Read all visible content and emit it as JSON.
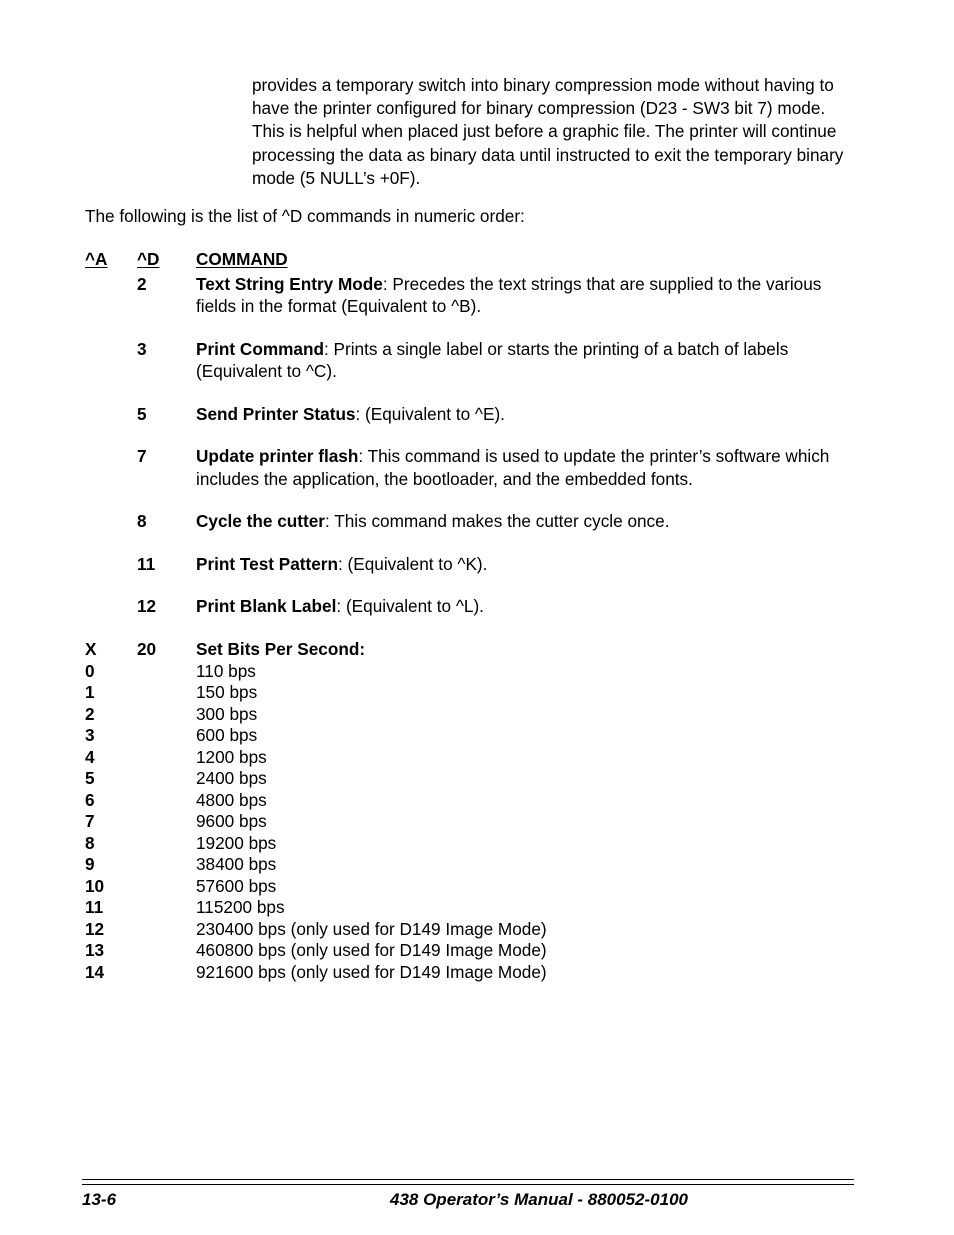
{
  "document": {
    "intro_paragraph": "provides a temporary switch into binary compression mode without having to have the printer configured for binary compression (D23 - SW3 bit 7) mode.  This is helpful when placed just before a graphic file. The printer will continue processing the data as binary data until instructed to exit the temporary binary mode (5 NULL’s +0F).",
    "lead_in": "The following is the list of ^D commands in numeric order:"
  },
  "command_table": {
    "headers": {
      "col_a": "^A",
      "col_d": "^D",
      "col_command": "COMMAND"
    },
    "rows": [
      {
        "col_a": "",
        "col_d": "2",
        "term": "Text String Entry Mode",
        "description": ": Precedes the text strings that are supplied to the various fields in the format (Equivalent to ^B)."
      },
      {
        "col_a": "",
        "col_d": "3",
        "term": "Print Command",
        "description": ": Prints a single label or starts the printing of a batch of labels (Equivalent to ^C)."
      },
      {
        "col_a": "",
        "col_d": "5",
        "term": "Send Printer Status",
        "description": ": (Equivalent to ^E)."
      },
      {
        "col_a": "",
        "col_d": "7",
        "term": "Update printer flash",
        "description": ":  This command is used to update the printer’s software which includes the application, the bootloader, and the embedded fonts."
      },
      {
        "col_a": "",
        "col_d": "8",
        "term": "Cycle the cutter",
        "description": ":  This command makes the cutter cycle once."
      },
      {
        "col_a": "",
        "col_d": "11",
        "term": "Print Test Pattern",
        "description": ": (Equivalent to ^K)."
      },
      {
        "col_a": "",
        "col_d": "12",
        "term": "Print Blank Label",
        "description": ": (Equivalent to ^L)."
      }
    ]
  },
  "bps_table": {
    "header": {
      "col_x": "X",
      "col_d": "20",
      "title": "Set Bits Per Second:"
    },
    "rows": [
      {
        "x": "0",
        "value": "110 bps"
      },
      {
        "x": "1",
        "value": "150 bps"
      },
      {
        "x": "2",
        "value": "300 bps"
      },
      {
        "x": "3",
        "value": "600 bps"
      },
      {
        "x": "4",
        "value": "1200 bps"
      },
      {
        "x": "5",
        "value": "2400 bps"
      },
      {
        "x": "6",
        "value": "4800 bps"
      },
      {
        "x": "7",
        "value": "9600 bps"
      },
      {
        "x": "8",
        "value": "19200 bps"
      },
      {
        "x": "9",
        "value": "38400 bps"
      },
      {
        "x": "10",
        "value": "57600 bps"
      },
      {
        "x": "11",
        "value": "115200 bps"
      },
      {
        "x": "12",
        "value": "230400 bps (only used for D149 Image Mode)"
      },
      {
        "x": "13",
        "value": "460800 bps (only used for D149 Image Mode)"
      },
      {
        "x": "14",
        "value": "921600 bps (only used for D149 Image Mode)"
      }
    ]
  },
  "footer": {
    "page_number": "13-6",
    "manual_title": "438 Operator’s Manual - 880052-0100"
  }
}
